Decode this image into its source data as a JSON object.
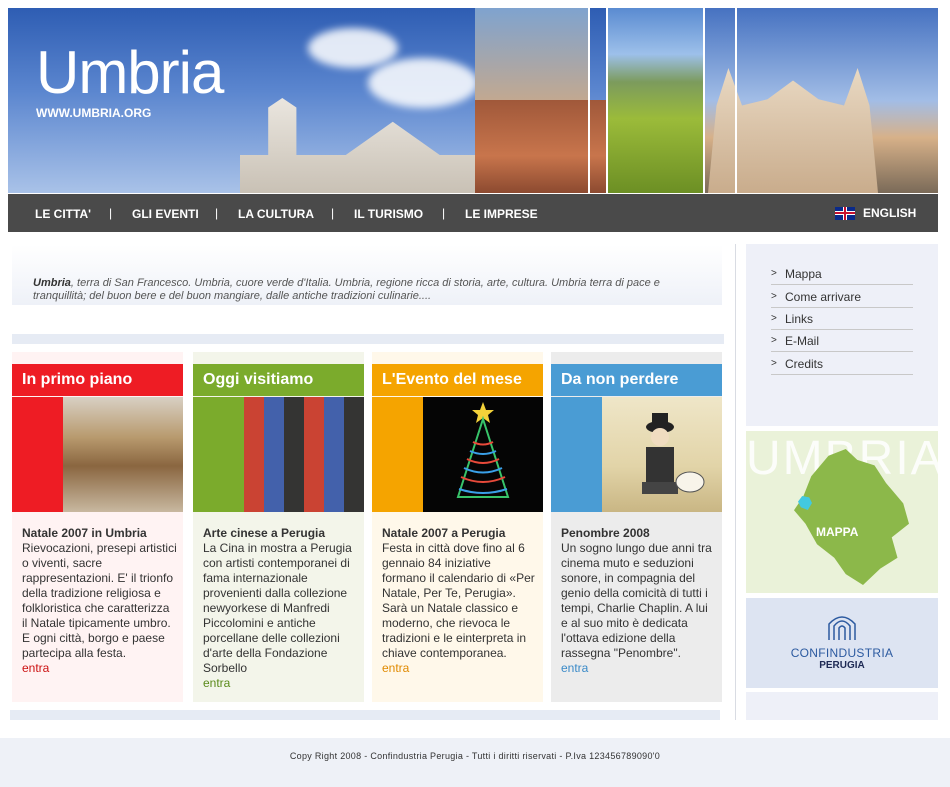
{
  "header": {
    "title": "Umbria",
    "url": "WWW.UMBRIA.ORG"
  },
  "nav": {
    "items": [
      {
        "label": "LE CITTA'"
      },
      {
        "label": "GLI EVENTI"
      },
      {
        "label": "LA CULTURA"
      },
      {
        "label": "IL TURISMO"
      },
      {
        "label": "LE IMPRESE"
      }
    ],
    "separator": "|",
    "language": "ENGLISH"
  },
  "intro": {
    "lead": "Umbria",
    "text": ", terra di San Francesco. Umbria, cuore verde d'Italia. Umbria, regione ricca di storia, arte, cultura. Umbria terra di pace e tranquillità; del buon bere e del buon mangiare, dalle antiche tradizioni culinarie...."
  },
  "cards": [
    {
      "heading": "In primo piano",
      "color": "#ee1c24",
      "bg": "#fff3f3",
      "link_color": "#cc1111",
      "title": "Natale 2007 in Umbria",
      "text": "Rievocazioni, presepi artistici o viventi, sacre rappresentazioni. E' il trionfo della tradizione religiosa e folkloristica che caratterizza il Natale tipicamente umbro. E ogni città, borgo e paese partecipa alla festa.",
      "more": "entra"
    },
    {
      "heading": "Oggi visitiamo",
      "color": "#7bab2c",
      "bg": "#f3f5ea",
      "link_color": "#5a8a1a",
      "title": "Arte cinese a Perugia",
      "text": "La Cina in mostra a Perugia con artisti contemporanei di fama internazionale provenienti dalla collezione newyorkese di Manfredi Piccolomini e antiche porcellane delle collezioni d'arte della Fondazione Sorbello",
      "more": "entra"
    },
    {
      "heading": "L'Evento del mese",
      "color": "#f5a400",
      "bg": "#fff8ea",
      "link_color": "#e08a00",
      "title": "Natale 2007 a Perugia",
      "text": "Festa in città dove fino al 6 gennaio 84 iniziative formano il calendario di «Per Natale, Per Te, Perugia». Sarà un Natale classico e moderno, che rievoca le tradizioni e le einterpreta in chiave contemporanea.",
      "more": "entra"
    },
    {
      "heading": "Da non perdere",
      "color": "#4a9cd4",
      "bg": "#ececec",
      "link_color": "#3a8ac8",
      "title": "Penombre 2008",
      "text": "Un sogno lungo due anni tra cinema muto e seduzioni sonore, in compagnia del genio della comicità di tutti i tempi, Charlie Chaplin. A lui e al suo mito è dedicata l'ottava edizione della rassegna \"Penombre\".",
      "more": "entra"
    }
  ],
  "sidebar": {
    "arrow": ">",
    "items": [
      {
        "label": "Mappa"
      },
      {
        "label": "Come arrivare"
      },
      {
        "label": "Links"
      },
      {
        "label": "E-Mail"
      },
      {
        "label": "Credits"
      }
    ],
    "map_watermark": "UMBRIA",
    "map_label": "MAPPA",
    "confindustria_name": "CONFINDUSTRIA",
    "confindustria_city": "PERUGIA"
  },
  "footer": {
    "text": "Copy Right 2008 - Confindustria Perugia - Tutti i diritti riservati - P.Iva 123456789090'0"
  }
}
